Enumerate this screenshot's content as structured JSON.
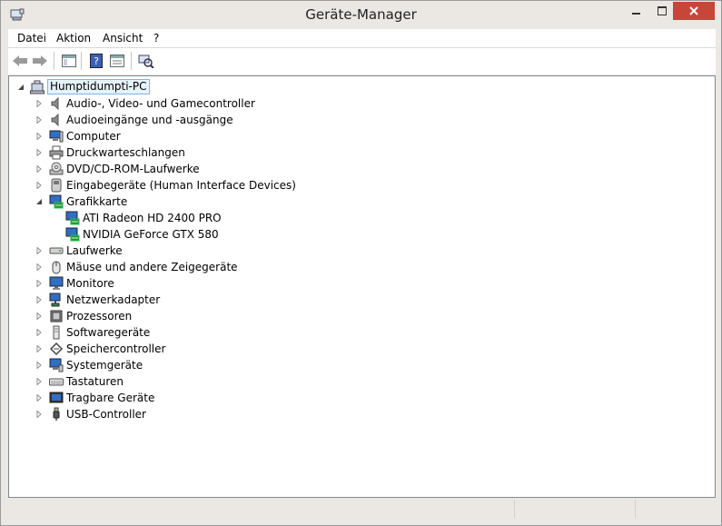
{
  "window": {
    "title": "Geräte-Manager"
  },
  "menu": {
    "items": [
      "Datei",
      "Aktion",
      "Ansicht",
      "?"
    ]
  },
  "tree": {
    "root": "Humptidumpti-PC",
    "categories": [
      {
        "label": "Audio-, Video- und Gamecontroller",
        "icon": "speaker-icon",
        "expanded": false
      },
      {
        "label": "Audioeingänge und -ausgänge",
        "icon": "speaker-icon",
        "expanded": false
      },
      {
        "label": "Computer",
        "icon": "computer-icon",
        "expanded": false
      },
      {
        "label": "Druckwarteschlangen",
        "icon": "printer-icon",
        "expanded": false
      },
      {
        "label": "DVD/CD-ROM-Laufwerke",
        "icon": "disc-drive-icon",
        "expanded": false
      },
      {
        "label": "Eingabegeräte (Human Interface Devices)",
        "icon": "hid-icon",
        "expanded": false
      },
      {
        "label": "Grafikkarte",
        "icon": "display-adapter-icon",
        "expanded": true
      },
      {
        "label": "ATI Radeon HD 2400 PRO",
        "icon": "display-adapter-icon",
        "child": true
      },
      {
        "label": "NVIDIA GeForce GTX 580",
        "icon": "display-adapter-icon",
        "child": true
      },
      {
        "label": "Laufwerke",
        "icon": "disk-drive-icon",
        "expanded": false
      },
      {
        "label": "Mäuse und andere Zeigegeräte",
        "icon": "mouse-icon",
        "expanded": false
      },
      {
        "label": "Monitore",
        "icon": "monitor-icon",
        "expanded": false
      },
      {
        "label": "Netzwerkadapter",
        "icon": "network-adapter-icon",
        "expanded": false
      },
      {
        "label": "Prozessoren",
        "icon": "processor-icon",
        "expanded": false
      },
      {
        "label": "Softwaregeräte",
        "icon": "software-device-icon",
        "expanded": false
      },
      {
        "label": "Speichercontroller",
        "icon": "storage-controller-icon",
        "expanded": false
      },
      {
        "label": "Systemgeräte",
        "icon": "system-device-icon",
        "expanded": false
      },
      {
        "label": "Tastaturen",
        "icon": "keyboard-icon",
        "expanded": false
      },
      {
        "label": "Tragbare Geräte",
        "icon": "portable-device-icon",
        "expanded": false
      },
      {
        "label": "USB-Controller",
        "icon": "usb-icon",
        "expanded": false
      }
    ]
  },
  "colors": {
    "close_button": "#c7463a",
    "selection_bg": "#e5f3fb",
    "selection_border": "#7eb4ea"
  }
}
